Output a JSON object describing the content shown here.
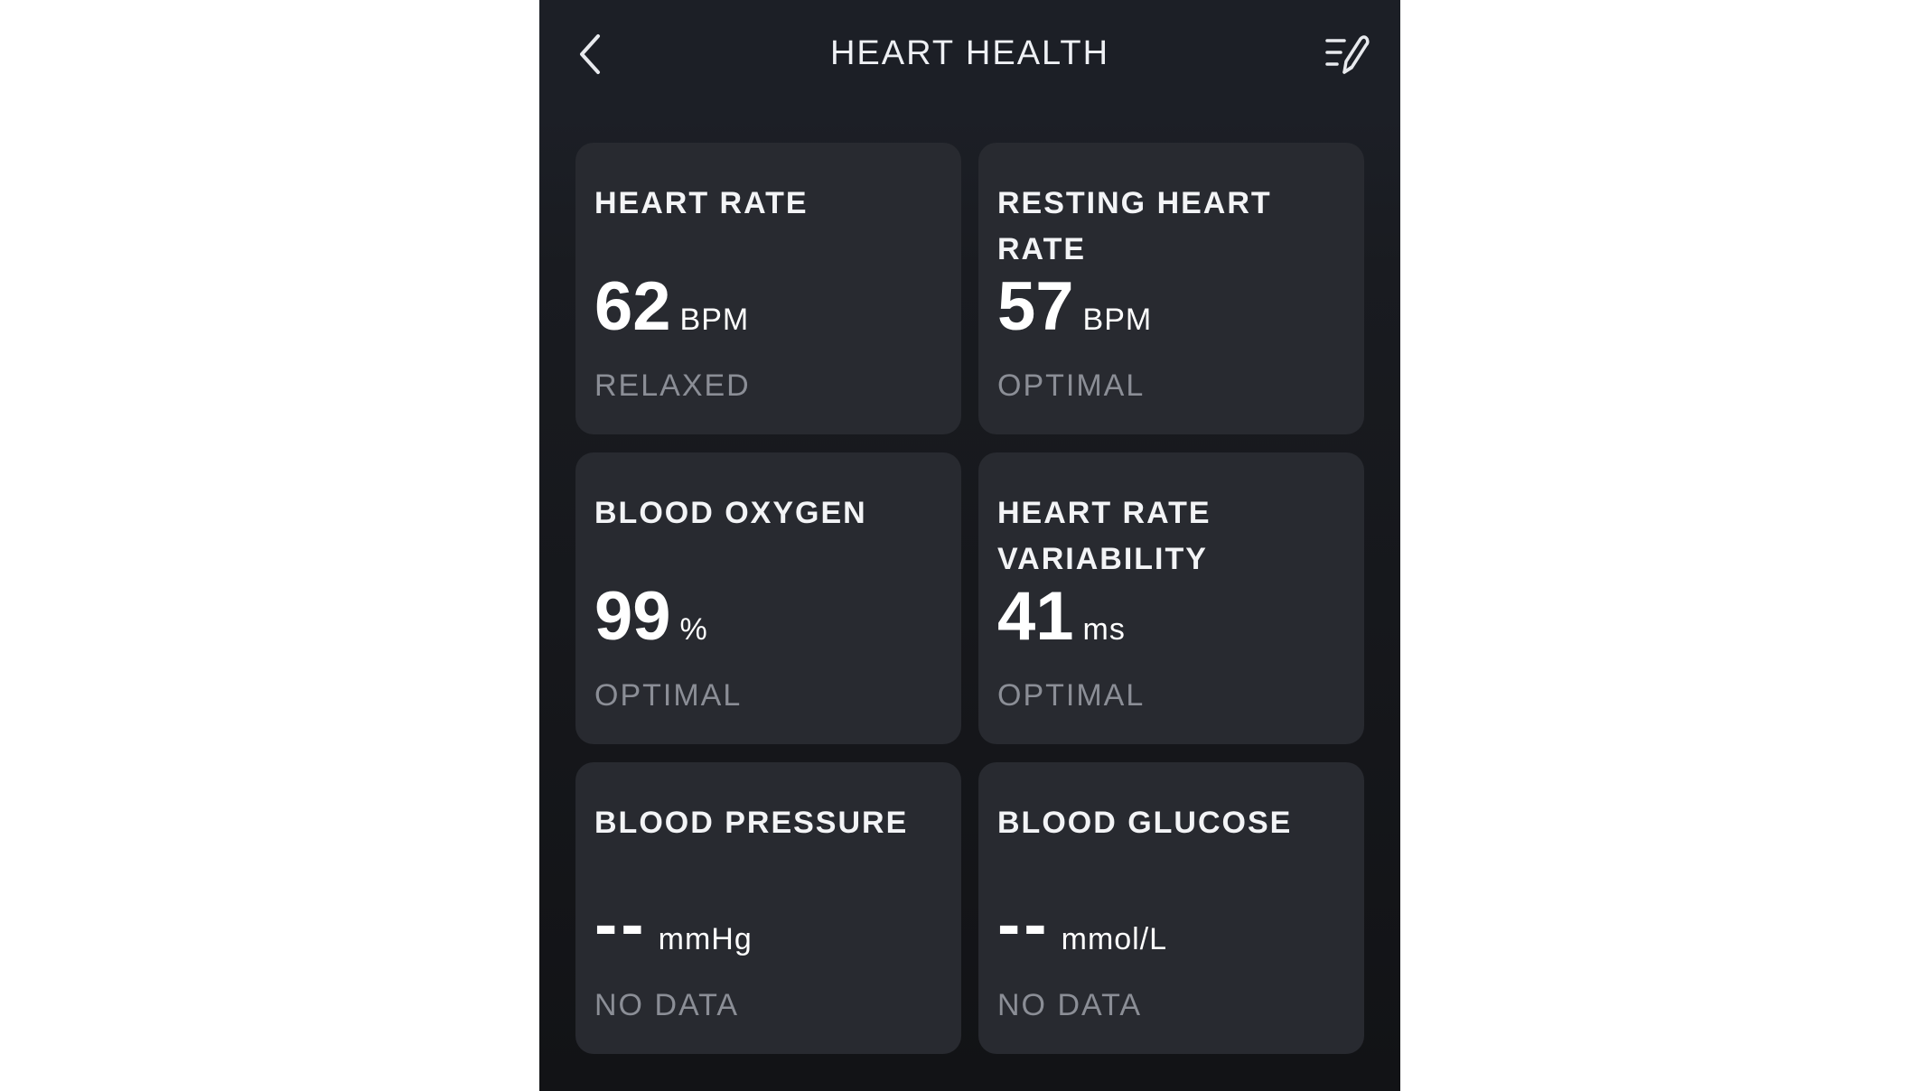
{
  "header": {
    "title": "HEART HEALTH",
    "back_icon": "chevron-left-icon",
    "edit_icon": "edit-list-icon"
  },
  "cards": [
    {
      "title": "HEART RATE",
      "value": "62",
      "unit": "BPM",
      "status": "RELAXED"
    },
    {
      "title": "RESTING HEART RATE",
      "value": "57",
      "unit": "BPM",
      "status": "OPTIMAL"
    },
    {
      "title": "BLOOD OXYGEN",
      "value": "99",
      "unit": "%",
      "status": "OPTIMAL"
    },
    {
      "title": "HEART RATE VARIABILITY",
      "value": "41",
      "unit": "ms",
      "status": "OPTIMAL"
    },
    {
      "title": "BLOOD PRESSURE",
      "value": "--",
      "unit": "mmHg",
      "status": "NO DATA"
    },
    {
      "title": "BLOOD GLUCOSE",
      "value": "--",
      "unit": "mmol/L",
      "status": "NO DATA"
    }
  ],
  "colors": {
    "background": "#1c1f26",
    "card": "#282a30",
    "text_primary": "#ffffff",
    "text_status": "#8b8e96"
  }
}
